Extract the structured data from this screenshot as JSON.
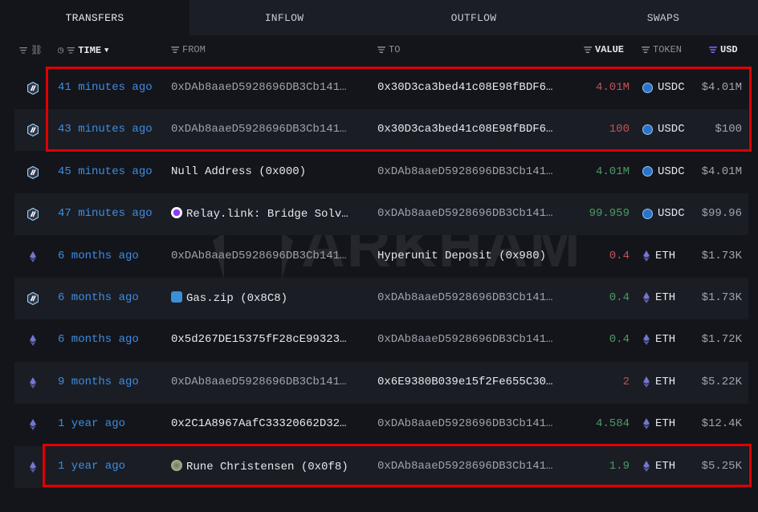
{
  "tabs": [
    "TRANSFERS",
    "INFLOW",
    "OUTFLOW",
    "SWAPS"
  ],
  "headers": {
    "time": "TIME",
    "from": "FROM",
    "to": "TO",
    "value": "VALUE",
    "token": "TOKEN",
    "usd": "USD"
  },
  "watermark": "ARKHAM",
  "colors": {
    "accent": "#3d8de0",
    "negative": "#c25356",
    "positive": "#4e9a62",
    "highlight": "#e00000"
  },
  "rows": [
    {
      "chain": "arbitrum",
      "time": "41 minutes ago",
      "from": "0xDAb8aaeD5928696DB3Cb141…",
      "to": "0x30D3ca3bed41c08E98fBDF6…",
      "value": "4.01M",
      "dir": "out",
      "token": "USDC",
      "usd": "$4.01M"
    },
    {
      "chain": "arbitrum",
      "time": "43 minutes ago",
      "from": "0xDAb8aaeD5928696DB3Cb141…",
      "to": "0x30D3ca3bed41c08E98fBDF6…",
      "value": "100",
      "dir": "out",
      "token": "USDC",
      "usd": "$100"
    },
    {
      "chain": "arbitrum",
      "time": "45 minutes ago",
      "from": "Null Address (0x000)",
      "to": "0xDAb8aaeD5928696DB3Cb141…",
      "value": "4.01M",
      "dir": "in",
      "token": "USDC",
      "usd": "$4.01M"
    },
    {
      "chain": "arbitrum",
      "time": "47 minutes ago",
      "from": "Relay.link: Bridge Solv…",
      "to": "0xDAb8aaeD5928696DB3Cb141…",
      "value": "99.959",
      "dir": "in",
      "token": "USDC",
      "usd": "$99.96"
    },
    {
      "chain": "ethereum",
      "time": "6 months ago",
      "from": "0xDAb8aaeD5928696DB3Cb141…",
      "to": "Hyperunit Deposit (0x980)",
      "value": "0.4",
      "dir": "out",
      "token": "ETH",
      "usd": "$1.73K"
    },
    {
      "chain": "arbitrum",
      "time": "6 months ago",
      "from": "Gas.zip (0x8C8)",
      "to": "0xDAb8aaeD5928696DB3Cb141…",
      "value": "0.4",
      "dir": "in",
      "token": "ETH",
      "usd": "$1.73K"
    },
    {
      "chain": "ethereum",
      "time": "6 months ago",
      "from": "0x5d267DE15375fF28cE99323…",
      "to": "0xDAb8aaeD5928696DB3Cb141…",
      "value": "0.4",
      "dir": "in",
      "token": "ETH",
      "usd": "$1.72K"
    },
    {
      "chain": "ethereum",
      "time": "9 months ago",
      "from": "0xDAb8aaeD5928696DB3Cb141…",
      "to": "0x6E9380B039e15f2Fe655C30…",
      "value": "2",
      "dir": "out",
      "token": "ETH",
      "usd": "$5.22K"
    },
    {
      "chain": "ethereum",
      "time": "1 year ago",
      "from": "0x2C1A8967AafC33320662D32…",
      "to": "0xDAb8aaeD5928696DB3Cb141…",
      "value": "4.584",
      "dir": "in",
      "token": "ETH",
      "usd": "$12.4K"
    },
    {
      "chain": "ethereum",
      "time": "1 year ago",
      "from": "Rune Christensen (0x0f8)",
      "to": "0xDAb8aaeD5928696DB3Cb141…",
      "value": "1.9",
      "dir": "in",
      "token": "ETH",
      "usd": "$5.25K"
    }
  ]
}
